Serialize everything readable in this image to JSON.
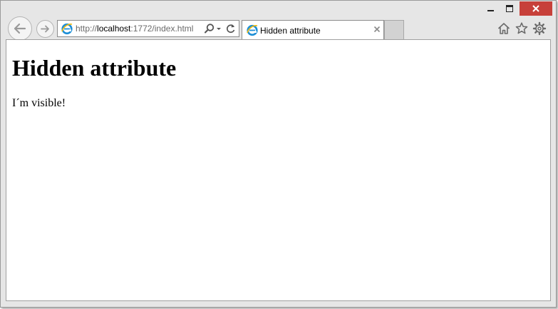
{
  "browser": {
    "address_bar": {
      "url_prefix": "http://",
      "url_host": "localhost",
      "url_rest": ":1772/index.html"
    },
    "tab": {
      "title": "Hidden attribute"
    }
  },
  "page": {
    "heading": "Hidden attribute",
    "paragraph": "I´m visible!"
  },
  "colors": {
    "close_button": "#c7403a",
    "ie_logo": "#1e8fd6",
    "ie_ring": "#f2b90c"
  },
  "icons": {
    "back": "back-arrow-icon",
    "forward": "forward-arrow-icon",
    "site": "internet-explorer-icon",
    "search": "search-icon",
    "dropdown": "chevron-down-icon",
    "refresh": "refresh-icon",
    "close_tab": "close-icon",
    "home": "home-icon",
    "favorites": "star-icon",
    "tools": "gear-icon"
  }
}
